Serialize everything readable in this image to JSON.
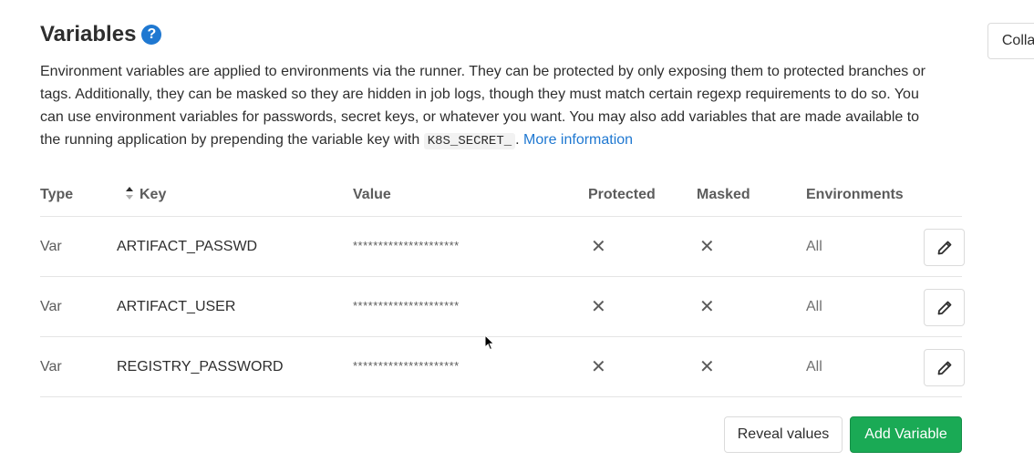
{
  "section": {
    "title": "Variables",
    "help_icon": "?",
    "collapse_label": "Collapse"
  },
  "description": {
    "text_before_code": "Environment variables are applied to environments via the runner. They can be protected by only exposing them to protected branches or tags. Additionally, they can be masked so they are hidden in job logs, though they must match certain regexp requirements to do so. You can use environment variables for passwords, secret keys, or whatever you want. You may also add variables that are made available to the running application by prepending the variable key with ",
    "code": "K8S_SECRET_",
    "text_after_code": ". ",
    "link": "More information"
  },
  "table": {
    "headers": {
      "type": "Type",
      "key": "Key",
      "value": "Value",
      "protected": "Protected",
      "masked": "Masked",
      "environments": "Environments"
    },
    "rows": [
      {
        "type": "Var",
        "key": "ARTIFACT_PASSWD",
        "value": "*********************",
        "protected": "✕",
        "masked": "✕",
        "environments": "All"
      },
      {
        "type": "Var",
        "key": "ARTIFACT_USER",
        "value": "*********************",
        "protected": "✕",
        "masked": "✕",
        "environments": "All"
      },
      {
        "type": "Var",
        "key": "REGISTRY_PASSWORD",
        "value": "*********************",
        "protected": "✕",
        "masked": "✕",
        "environments": "All"
      }
    ]
  },
  "actions": {
    "reveal_label": "Reveal values",
    "add_label": "Add Variable"
  },
  "icons": {
    "help": "question-circle-icon",
    "sort": "sort-icon",
    "edit": "pencil-icon"
  },
  "colors": {
    "accent": "#1f78d1",
    "add_button": "#1aaa55"
  }
}
